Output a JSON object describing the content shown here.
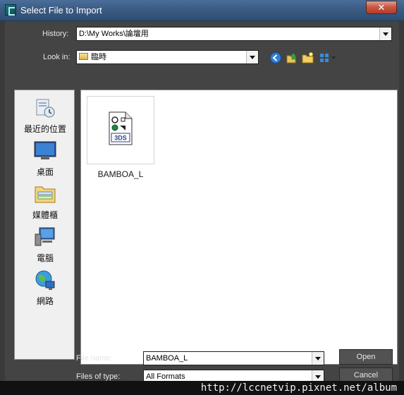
{
  "window": {
    "title": "Select File to Import",
    "close_glyph": "✕"
  },
  "history": {
    "label": "History:",
    "value": "D:\\My Works\\論壇用"
  },
  "lookin": {
    "label": "Look in:",
    "value": "臨時"
  },
  "toolbar": {
    "icons": [
      "back-icon",
      "up-folder-icon",
      "new-folder-icon",
      "view-menu-icon"
    ]
  },
  "places": [
    {
      "label": "最近的位置",
      "icon": "recent-places-icon"
    },
    {
      "label": "桌面",
      "icon": "desktop-icon"
    },
    {
      "label": "媒體櫃",
      "icon": "libraries-icon"
    },
    {
      "label": "電腦",
      "icon": "computer-icon"
    },
    {
      "label": "網路",
      "icon": "network-icon"
    }
  ],
  "files": [
    {
      "name": "BAMBOA_L",
      "type_badge": "3DS"
    }
  ],
  "filename": {
    "label": "File name:",
    "value": "BAMBOA_L"
  },
  "filetype": {
    "label": "Files of type:",
    "value": "All Formats"
  },
  "buttons": {
    "open": "Open",
    "cancel": "Cancel"
  },
  "watermark": "http://lccnetvip.pixnet.net/album"
}
